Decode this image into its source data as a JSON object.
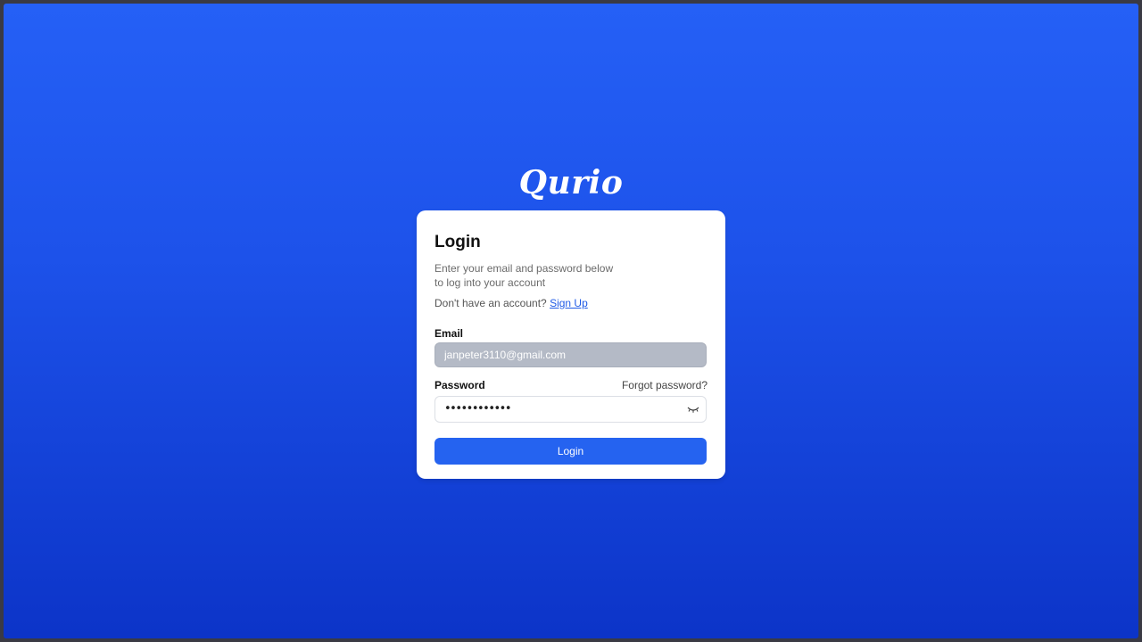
{
  "brand": {
    "logo_text": "Qurio"
  },
  "login": {
    "title": "Login",
    "subtitle_line1": "Enter your email and password below",
    "subtitle_line2": "to log into your account",
    "no_account_text": "Don't have an account?",
    "signup_link": "Sign Up",
    "email_label": "Email",
    "email_value": "janpeter3110@gmail.com",
    "password_label": "Password",
    "forgot_password": "Forgot password?",
    "password_masked": "••••••••••••",
    "password_toggle_icon": "eye-closed-icon",
    "submit_label": "Login"
  },
  "colors": {
    "background_top": "#2560f6",
    "background_bottom": "#0c34c8",
    "accent": "#2563f0",
    "link": "#1f5ae6"
  }
}
